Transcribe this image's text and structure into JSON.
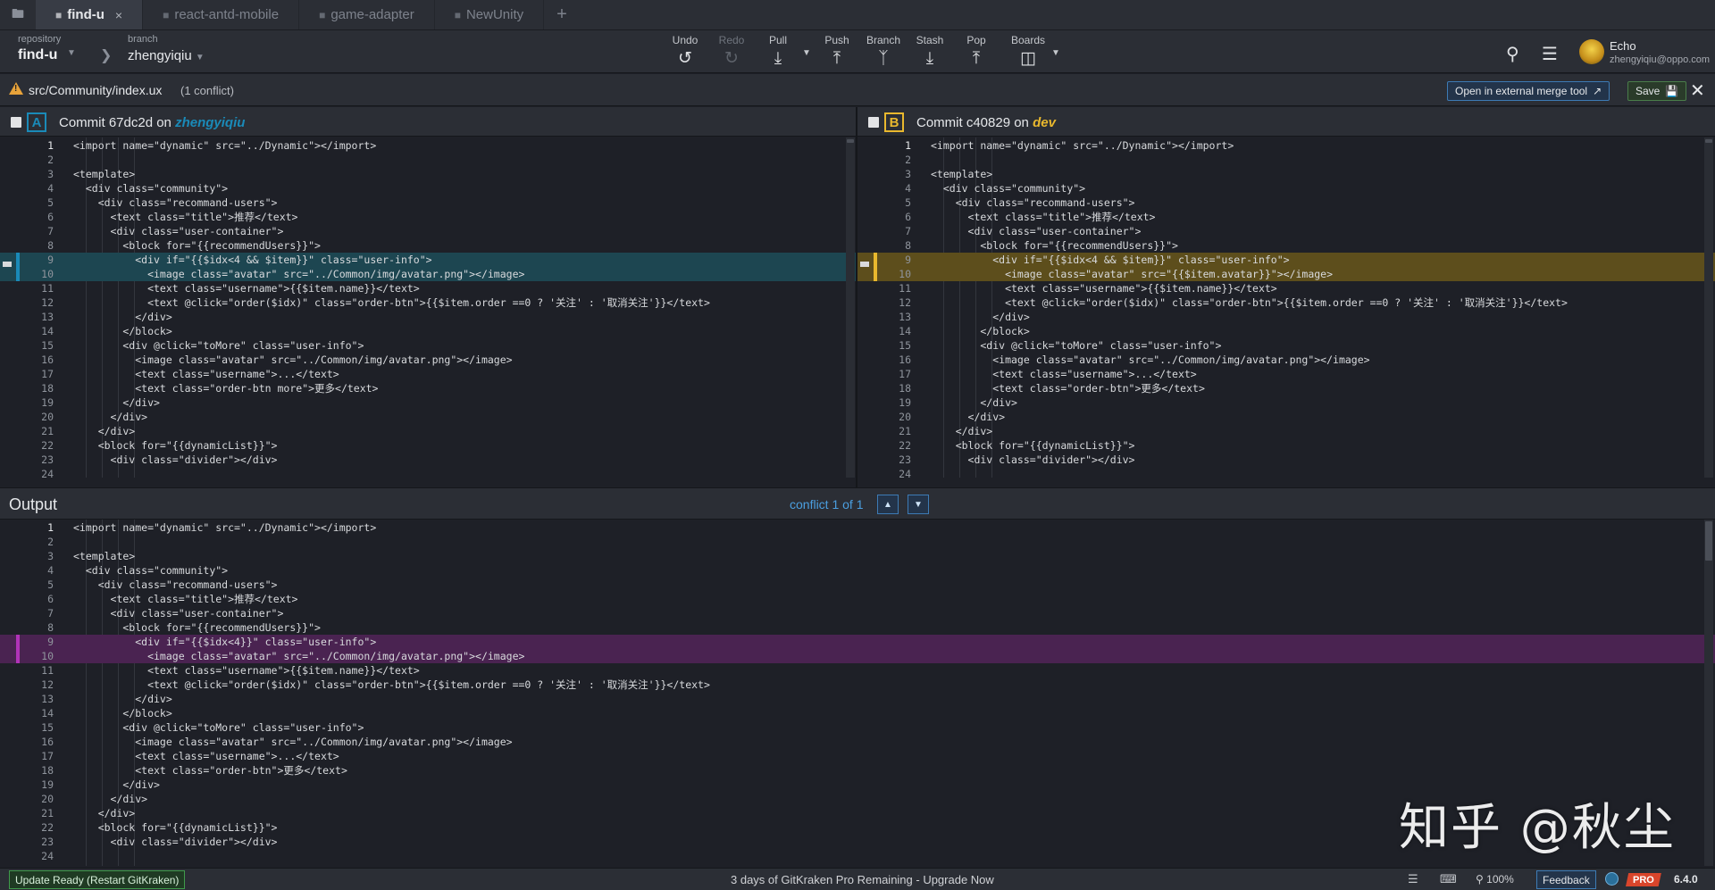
{
  "tabs": [
    {
      "label": "find-u",
      "active": true
    },
    {
      "label": "react-antd-mobile",
      "active": false
    },
    {
      "label": "game-adapter",
      "active": false
    },
    {
      "label": "NewUnity",
      "active": false
    }
  ],
  "toolbar": {
    "repo_label": "repository",
    "repo_name": "find-u",
    "branch_label": "branch",
    "branch_name": "zhengyiqiu",
    "undo": "Undo",
    "redo": "Redo",
    "pull": "Pull",
    "push": "Push",
    "branch": "Branch",
    "stash": "Stash",
    "pop": "Pop",
    "boards": "Boards"
  },
  "user": {
    "name": "Echo",
    "email": "zhengyiqiu@oppo.com"
  },
  "filebar": {
    "path": "src/Community/index.ux",
    "conflict_count": "(1 conflict)",
    "merge_tool": "Open in external merge tool",
    "save": "Save"
  },
  "panel_a": {
    "letter": "A",
    "commit": "Commit 67dc2d on",
    "branch": "zhengyiqiu"
  },
  "panel_b": {
    "letter": "B",
    "commit": "Commit c40829 on",
    "branch": "dev"
  },
  "colors": {
    "a": "#1a8ab8",
    "b": "#e9b82e",
    "output_conflict": "#b133b8"
  },
  "code_a": [
    "<import name=\"dynamic\" src=\"../Dynamic\"></import>",
    "",
    "<template>",
    "  <div class=\"community\">",
    "    <div class=\"recommand-users\">",
    "      <text class=\"title\">推荐</text>",
    "      <div class=\"user-container\">",
    "        <block for=\"{{recommendUsers}}\">",
    "          <div if=\"{{$idx<4 && $item}}\" class=\"user-info\">",
    "            <image class=\"avatar\" src=\"../Common/img/avatar.png\"></image>",
    "            <text class=\"username\">{{$item.name}}</text>",
    "            <text @click=\"order($idx)\" class=\"order-btn\">{{$item.order ==0 ? '关注' : '取消关注'}}</text>",
    "          </div>",
    "        </block>",
    "        <div @click=\"toMore\" class=\"user-info\">",
    "          <image class=\"avatar\" src=\"../Common/img/avatar.png\"></image>",
    "          <text class=\"username\">...</text>",
    "          <text class=\"order-btn more\">更多</text>",
    "        </div>",
    "      </div>",
    "    </div>",
    "    <block for=\"{{dynamicList}}\">",
    "      <div class=\"divider\"></div>",
    ""
  ],
  "code_b": [
    "<import name=\"dynamic\" src=\"../Dynamic\"></import>",
    "",
    "<template>",
    "  <div class=\"community\">",
    "    <div class=\"recommand-users\">",
    "      <text class=\"title\">推荐</text>",
    "      <div class=\"user-container\">",
    "        <block for=\"{{recommendUsers}}\">",
    "          <div if=\"{{$idx<4 && $item}}\" class=\"user-info\">",
    "            <image class=\"avatar\" src=\"{{$item.avatar}}\"></image>",
    "            <text class=\"username\">{{$item.name}}</text>",
    "            <text @click=\"order($idx)\" class=\"order-btn\">{{$item.order ==0 ? '关注' : '取消关注'}}</text>",
    "          </div>",
    "        </block>",
    "        <div @click=\"toMore\" class=\"user-info\">",
    "          <image class=\"avatar\" src=\"../Common/img/avatar.png\"></image>",
    "          <text class=\"username\">...</text>",
    "          <text class=\"order-btn\">更多</text>",
    "        </div>",
    "      </div>",
    "    </div>",
    "    <block for=\"{{dynamicList}}\">",
    "      <div class=\"divider\"></div>",
    ""
  ],
  "output": {
    "title": "Output",
    "conflict_nav": "conflict 1 of 1",
    "code": [
      "<import name=\"dynamic\" src=\"../Dynamic\"></import>",
      "",
      "<template>",
      "  <div class=\"community\">",
      "    <div class=\"recommand-users\">",
      "      <text class=\"title\">推荐</text>",
      "      <div class=\"user-container\">",
      "        <block for=\"{{recommendUsers}}\">",
      "          <div if=\"{{$idx<4}}\" class=\"user-info\">",
      "            <image class=\"avatar\" src=\"../Common/img/avatar.png\"></image>",
      "            <text class=\"username\">{{$item.name}}</text>",
      "            <text @click=\"order($idx)\" class=\"order-btn\">{{$item.order ==0 ? '关注' : '取消关注'}}</text>",
      "          </div>",
      "        </block>",
      "        <div @click=\"toMore\" class=\"user-info\">",
      "          <image class=\"avatar\" src=\"../Common/img/avatar.png\"></image>",
      "          <text class=\"username\">...</text>",
      "          <text class=\"order-btn\">更多</text>",
      "        </div>",
      "      </div>",
      "    </div>",
      "    <block for=\"{{dynamicList}}\">",
      "      <div class=\"divider\"></div>",
      ""
    ]
  },
  "conflict_lines": [
    9,
    10
  ],
  "status": {
    "update": "Update Ready (Restart GitKraken)",
    "pro_message": "3 days of GitKraken Pro Remaining - Upgrade Now",
    "zoom": "100%",
    "feedback": "Feedback",
    "pro": "PRO",
    "version": "6.4.0"
  },
  "watermark": "知乎 @秋尘"
}
